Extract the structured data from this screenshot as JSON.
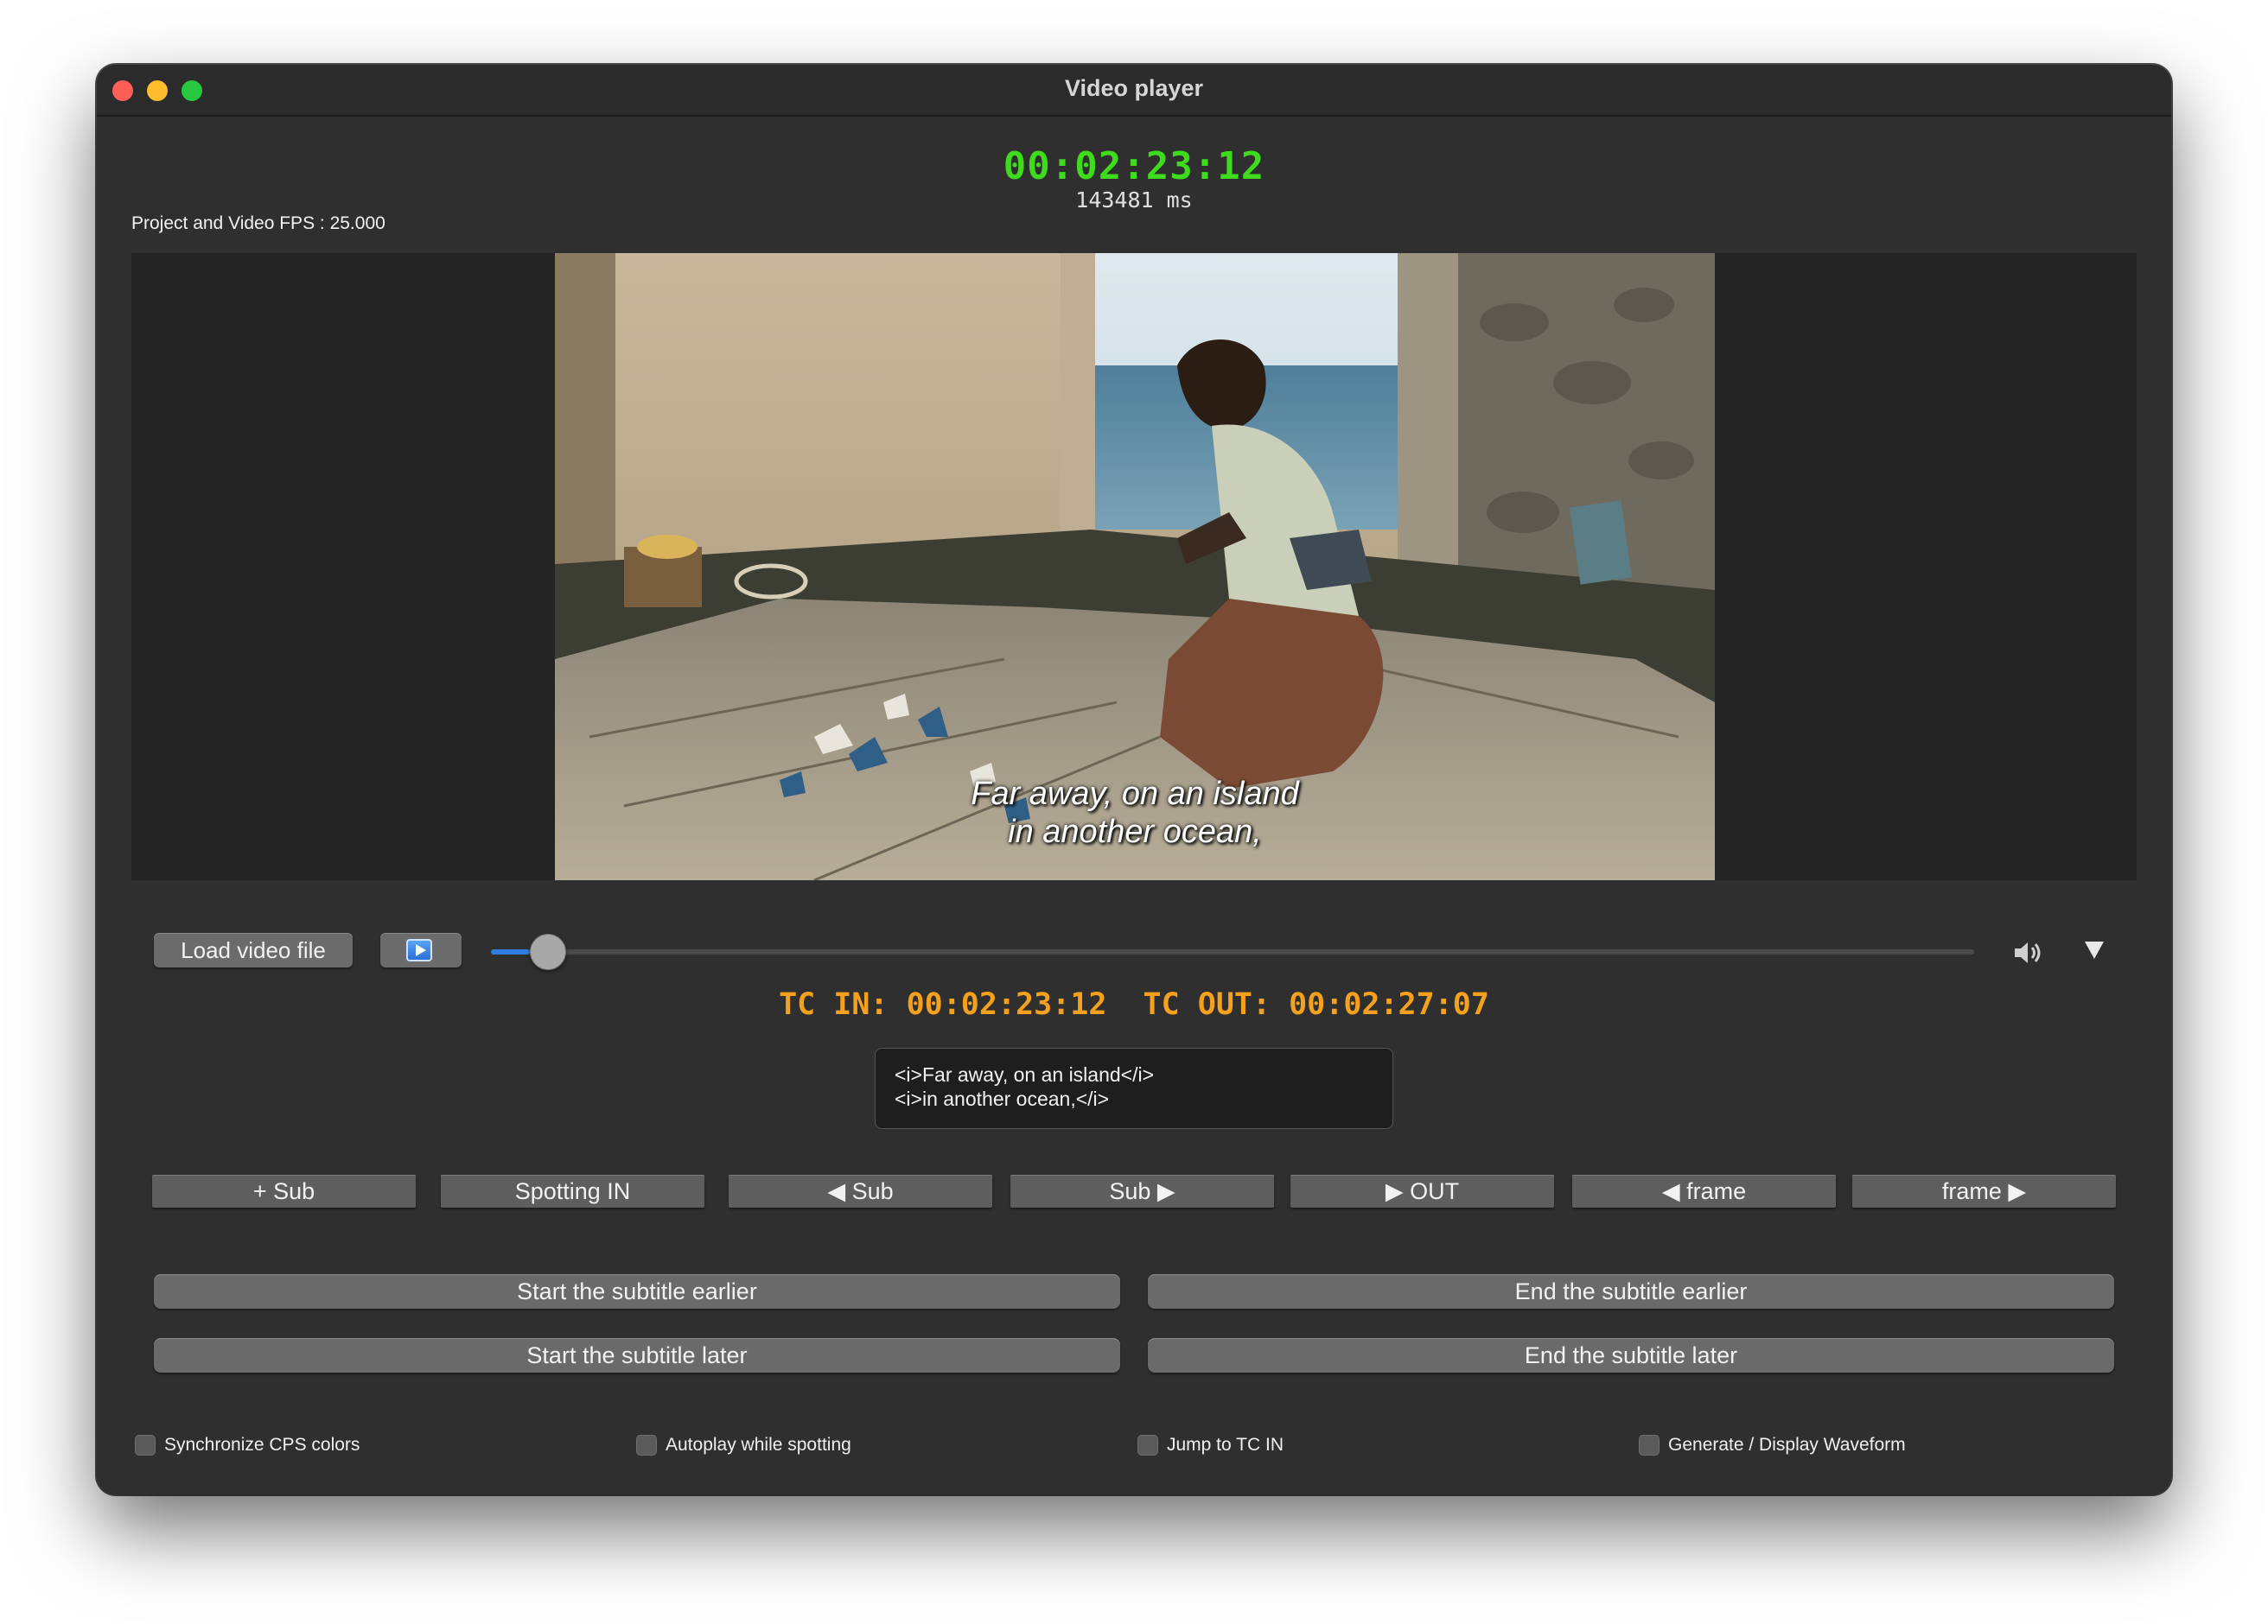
{
  "window": {
    "title": "Video player"
  },
  "timecode": {
    "current": "00:02:23:12",
    "milliseconds": "143481 ms",
    "fps_label": "Project and Video FPS : 25.000"
  },
  "video": {
    "subtitle_lines": [
      "Far away, on an island",
      "in another ocean,"
    ]
  },
  "playback": {
    "load_label": "Load video file",
    "progress_fraction": 0.026,
    "play_icon": "play-icon",
    "volume_icon": "speaker-icon",
    "menu_icon": "triangle-down-icon"
  },
  "tc": {
    "line": "TC IN: 00:02:23:12  TC OUT: 00:02:27:07"
  },
  "subtitle_editor": {
    "line1": "<i>Far away, on an island</i>",
    "line2": "<i>in another ocean,</i>"
  },
  "nav_buttons": [
    "+ Sub",
    "Spotting IN",
    "◀ Sub",
    "Sub ▶",
    "▶ OUT",
    "◀ frame",
    "frame ▶"
  ],
  "timing_buttons": {
    "start_earlier": "Start the subtitle earlier",
    "end_earlier": "End the subtitle earlier",
    "start_later": "Start the subtitle later",
    "end_later": "End the subtitle later"
  },
  "options": [
    "Synchronize CPS colors",
    "Autoplay while spotting",
    "Jump to TC IN",
    "Generate / Display Waveform"
  ],
  "colors": {
    "timecode_green": "#3fdc1e",
    "tc_orange": "#f5a11e",
    "slider_blue": "#2f7de1"
  }
}
